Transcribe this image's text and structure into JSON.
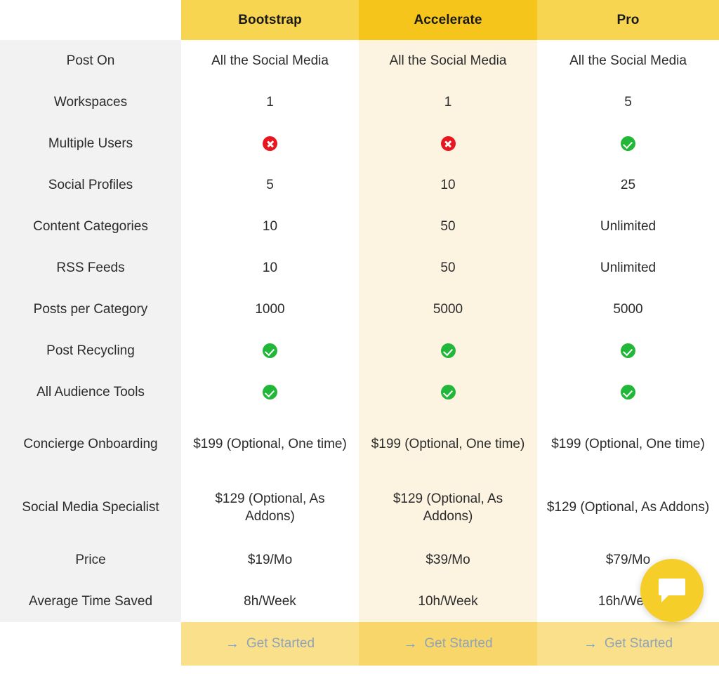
{
  "table": {
    "feature_column_header": "",
    "plans": [
      {
        "name": "Bootstrap",
        "accent": "#F8D551",
        "column_bg": "#FFFFFF",
        "cta_bg": "#FAE08B"
      },
      {
        "name": "Accelerate",
        "accent": "#F5C51C",
        "column_bg": "#FCF3E0",
        "cta_bg": "#F8D66A"
      },
      {
        "name": "Pro",
        "accent": "#F8D551",
        "column_bg": "#FFFFFF",
        "cta_bg": "#FAE08B"
      }
    ],
    "rows": [
      {
        "label": "Post On",
        "values": [
          "All the Social Media",
          "All the Social Media",
          "All the Social Media"
        ],
        "types": [
          "text",
          "text",
          "text"
        ]
      },
      {
        "label": "Workspaces",
        "values": [
          "1",
          "1",
          "5"
        ],
        "types": [
          "text",
          "text",
          "text"
        ]
      },
      {
        "label": "Multiple Users",
        "values": [
          "cross-icon",
          "cross-icon",
          "check-icon"
        ],
        "types": [
          "icon",
          "icon",
          "icon"
        ]
      },
      {
        "label": "Social Profiles",
        "values": [
          "5",
          "10",
          "25"
        ],
        "types": [
          "text",
          "text",
          "text"
        ]
      },
      {
        "label": "Content Categories",
        "values": [
          "10",
          "50",
          "Unlimited"
        ],
        "types": [
          "text",
          "text",
          "text"
        ]
      },
      {
        "label": "RSS Feeds",
        "values": [
          "10",
          "50",
          "Unlimited"
        ],
        "types": [
          "text",
          "text",
          "text"
        ]
      },
      {
        "label": "Posts per Category",
        "values": [
          "1000",
          "5000",
          "5000"
        ],
        "types": [
          "text",
          "text",
          "text"
        ]
      },
      {
        "label": "Post Recycling",
        "values": [
          "check-icon",
          "check-icon",
          "check-icon"
        ],
        "types": [
          "icon",
          "icon",
          "icon"
        ]
      },
      {
        "label": "All Audience Tools",
        "values": [
          "check-icon",
          "check-icon",
          "check-icon"
        ],
        "types": [
          "icon",
          "icon",
          "icon"
        ]
      },
      {
        "label": "Concierge Onboarding",
        "values": [
          "$199 (Optional, One time)",
          "$199 (Optional, One time)",
          "$199 (Optional, One time)"
        ],
        "types": [
          "text",
          "text",
          "text"
        ],
        "tall": true
      },
      {
        "label": "Social Media Specialist",
        "values": [
          "$129 (Optional, As Addons)",
          "$129 (Optional, As Addons)",
          "$129 (Optional, As Addons)"
        ],
        "types": [
          "text",
          "text",
          "text"
        ],
        "tall": true
      },
      {
        "label": "Price",
        "values": [
          "$19/Mo",
          "$39/Mo",
          "$79/Mo"
        ],
        "types": [
          "text",
          "text",
          "text"
        ]
      },
      {
        "label": "Average Time Saved",
        "values": [
          "8h/Week",
          "10h/Week",
          "16h/Week"
        ],
        "types": [
          "text",
          "text",
          "text"
        ]
      }
    ],
    "cta": {
      "label": "Get Started",
      "arrow_glyph": "→",
      "arrow_color": "#6FA8E8",
      "text_color": "#8FA3B8"
    }
  },
  "icons": {
    "check": {
      "name": "check-icon",
      "color": "#21B738"
    },
    "cross": {
      "name": "cross-icon",
      "color": "#E8161F"
    }
  },
  "chat_widget": {
    "name": "chat-bubble-icon",
    "background": "#F5CE2A",
    "icon_color": "#FFFFFF"
  },
  "colors": {
    "label_column_bg": "#F2F2F2",
    "page_bg": "#FFFFFF",
    "text": "#2B2B2B",
    "header_text": "#1A1A1A"
  }
}
